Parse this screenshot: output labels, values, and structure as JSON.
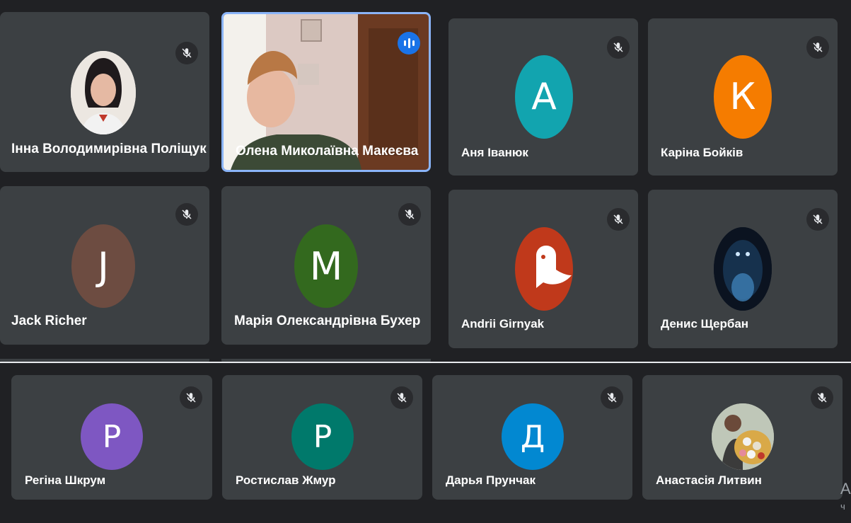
{
  "participants": [
    {
      "name": "Інна Володимирівна Поліщук",
      "avatar_type": "photo-woman",
      "muted": true
    },
    {
      "name": "Олена Миколаївна Макеєва",
      "avatar_type": "video",
      "speaking": true
    },
    {
      "name": "Аня Іванюк",
      "initial": "А",
      "color": "#12a4af",
      "muted": true
    },
    {
      "name": "Каріна Бойків",
      "initial": "К",
      "color": "#f57c00",
      "muted": true
    },
    {
      "name": "Jack Richer",
      "initial": "J",
      "color": "#6d4c41",
      "muted": true
    },
    {
      "name": "Марія Олександрівна Бухер",
      "initial": "М",
      "color": "#33691e",
      "muted": true
    },
    {
      "name": "Andrii Girnyak",
      "avatar_type": "ghost-logo",
      "color": "#c0391b",
      "muted": true
    },
    {
      "name": "Денис Щербан",
      "avatar_type": "photo-dark",
      "muted": true
    },
    {
      "name": "Регіна Шкрум",
      "initial": "Р",
      "color": "#7e57c2",
      "muted": true
    },
    {
      "name": "Ростислав Жмур",
      "initial": "Р",
      "color": "#00796b",
      "muted": true
    },
    {
      "name": "Дарья Прунчак",
      "initial": "Д",
      "color": "#0288d1",
      "muted": true
    },
    {
      "name": "Анастасія Литвин",
      "avatar_type": "photo-flowers",
      "muted": true
    }
  ],
  "corner_text": {
    "line1": "A",
    "line2": "ч"
  },
  "icons": {
    "mute": "mic-off-icon",
    "speaking": "audio-level-icon"
  }
}
